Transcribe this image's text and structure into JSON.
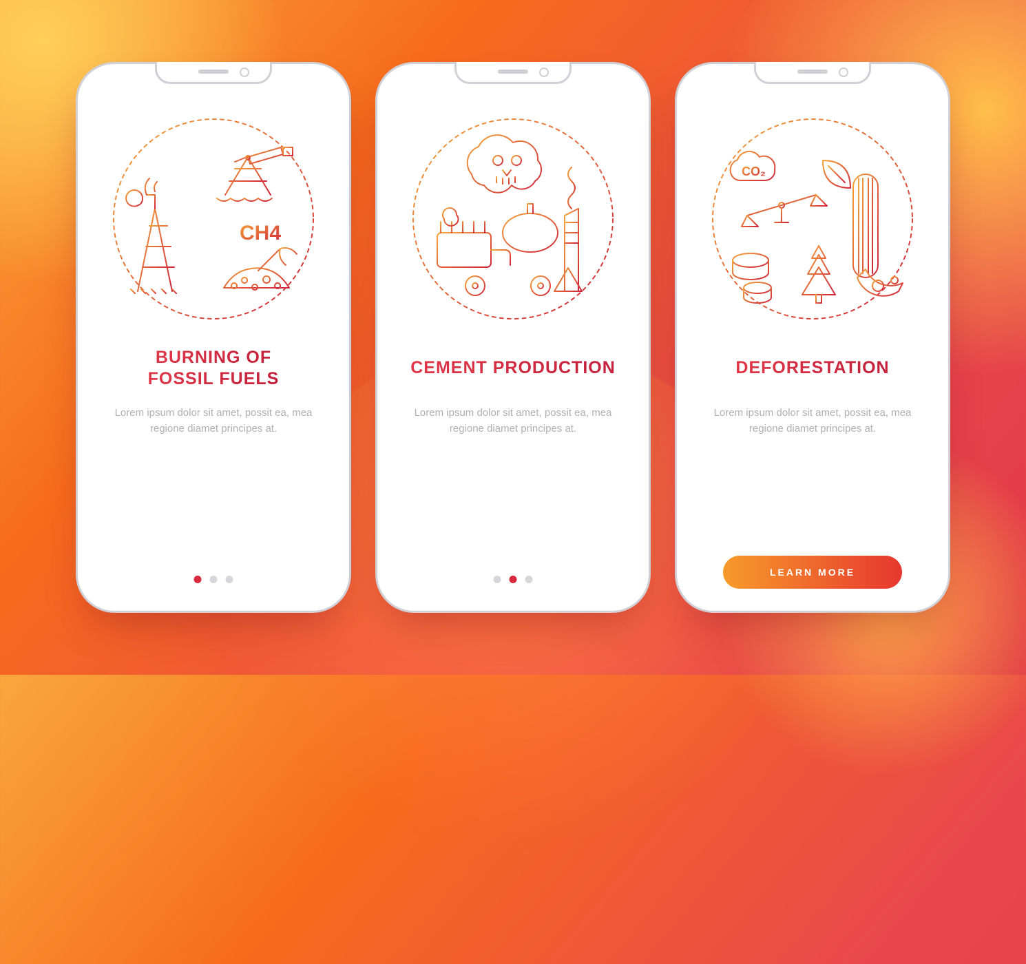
{
  "colors": {
    "grad_from": "#f5a63a",
    "grad_to": "#d0253a"
  },
  "screens": [
    {
      "icon": "fossil-fuels-illustration",
      "icon_text": "CH4",
      "title": "BURNING OF\nFOSSIL FUELS",
      "body": "Lorem ipsum dolor sit amet, possit ea, mea regione diamet principes at.",
      "active_dot": 0,
      "show_dots": true,
      "show_cta": false
    },
    {
      "icon": "cement-production-illustration",
      "title": "CEMENT PRODUCTION",
      "body": "Lorem ipsum dolor sit amet, possit ea, mea regione diamet principes at.",
      "active_dot": 1,
      "show_dots": true,
      "show_cta": false
    },
    {
      "icon": "deforestation-illustration",
      "icon_text": "CO₂",
      "title": "DEFORESTATION",
      "body": "Lorem ipsum dolor sit amet, possit ea, mea regione diamet principes at.",
      "show_dots": false,
      "show_cta": true,
      "cta_label": "LEARN MORE"
    }
  ]
}
